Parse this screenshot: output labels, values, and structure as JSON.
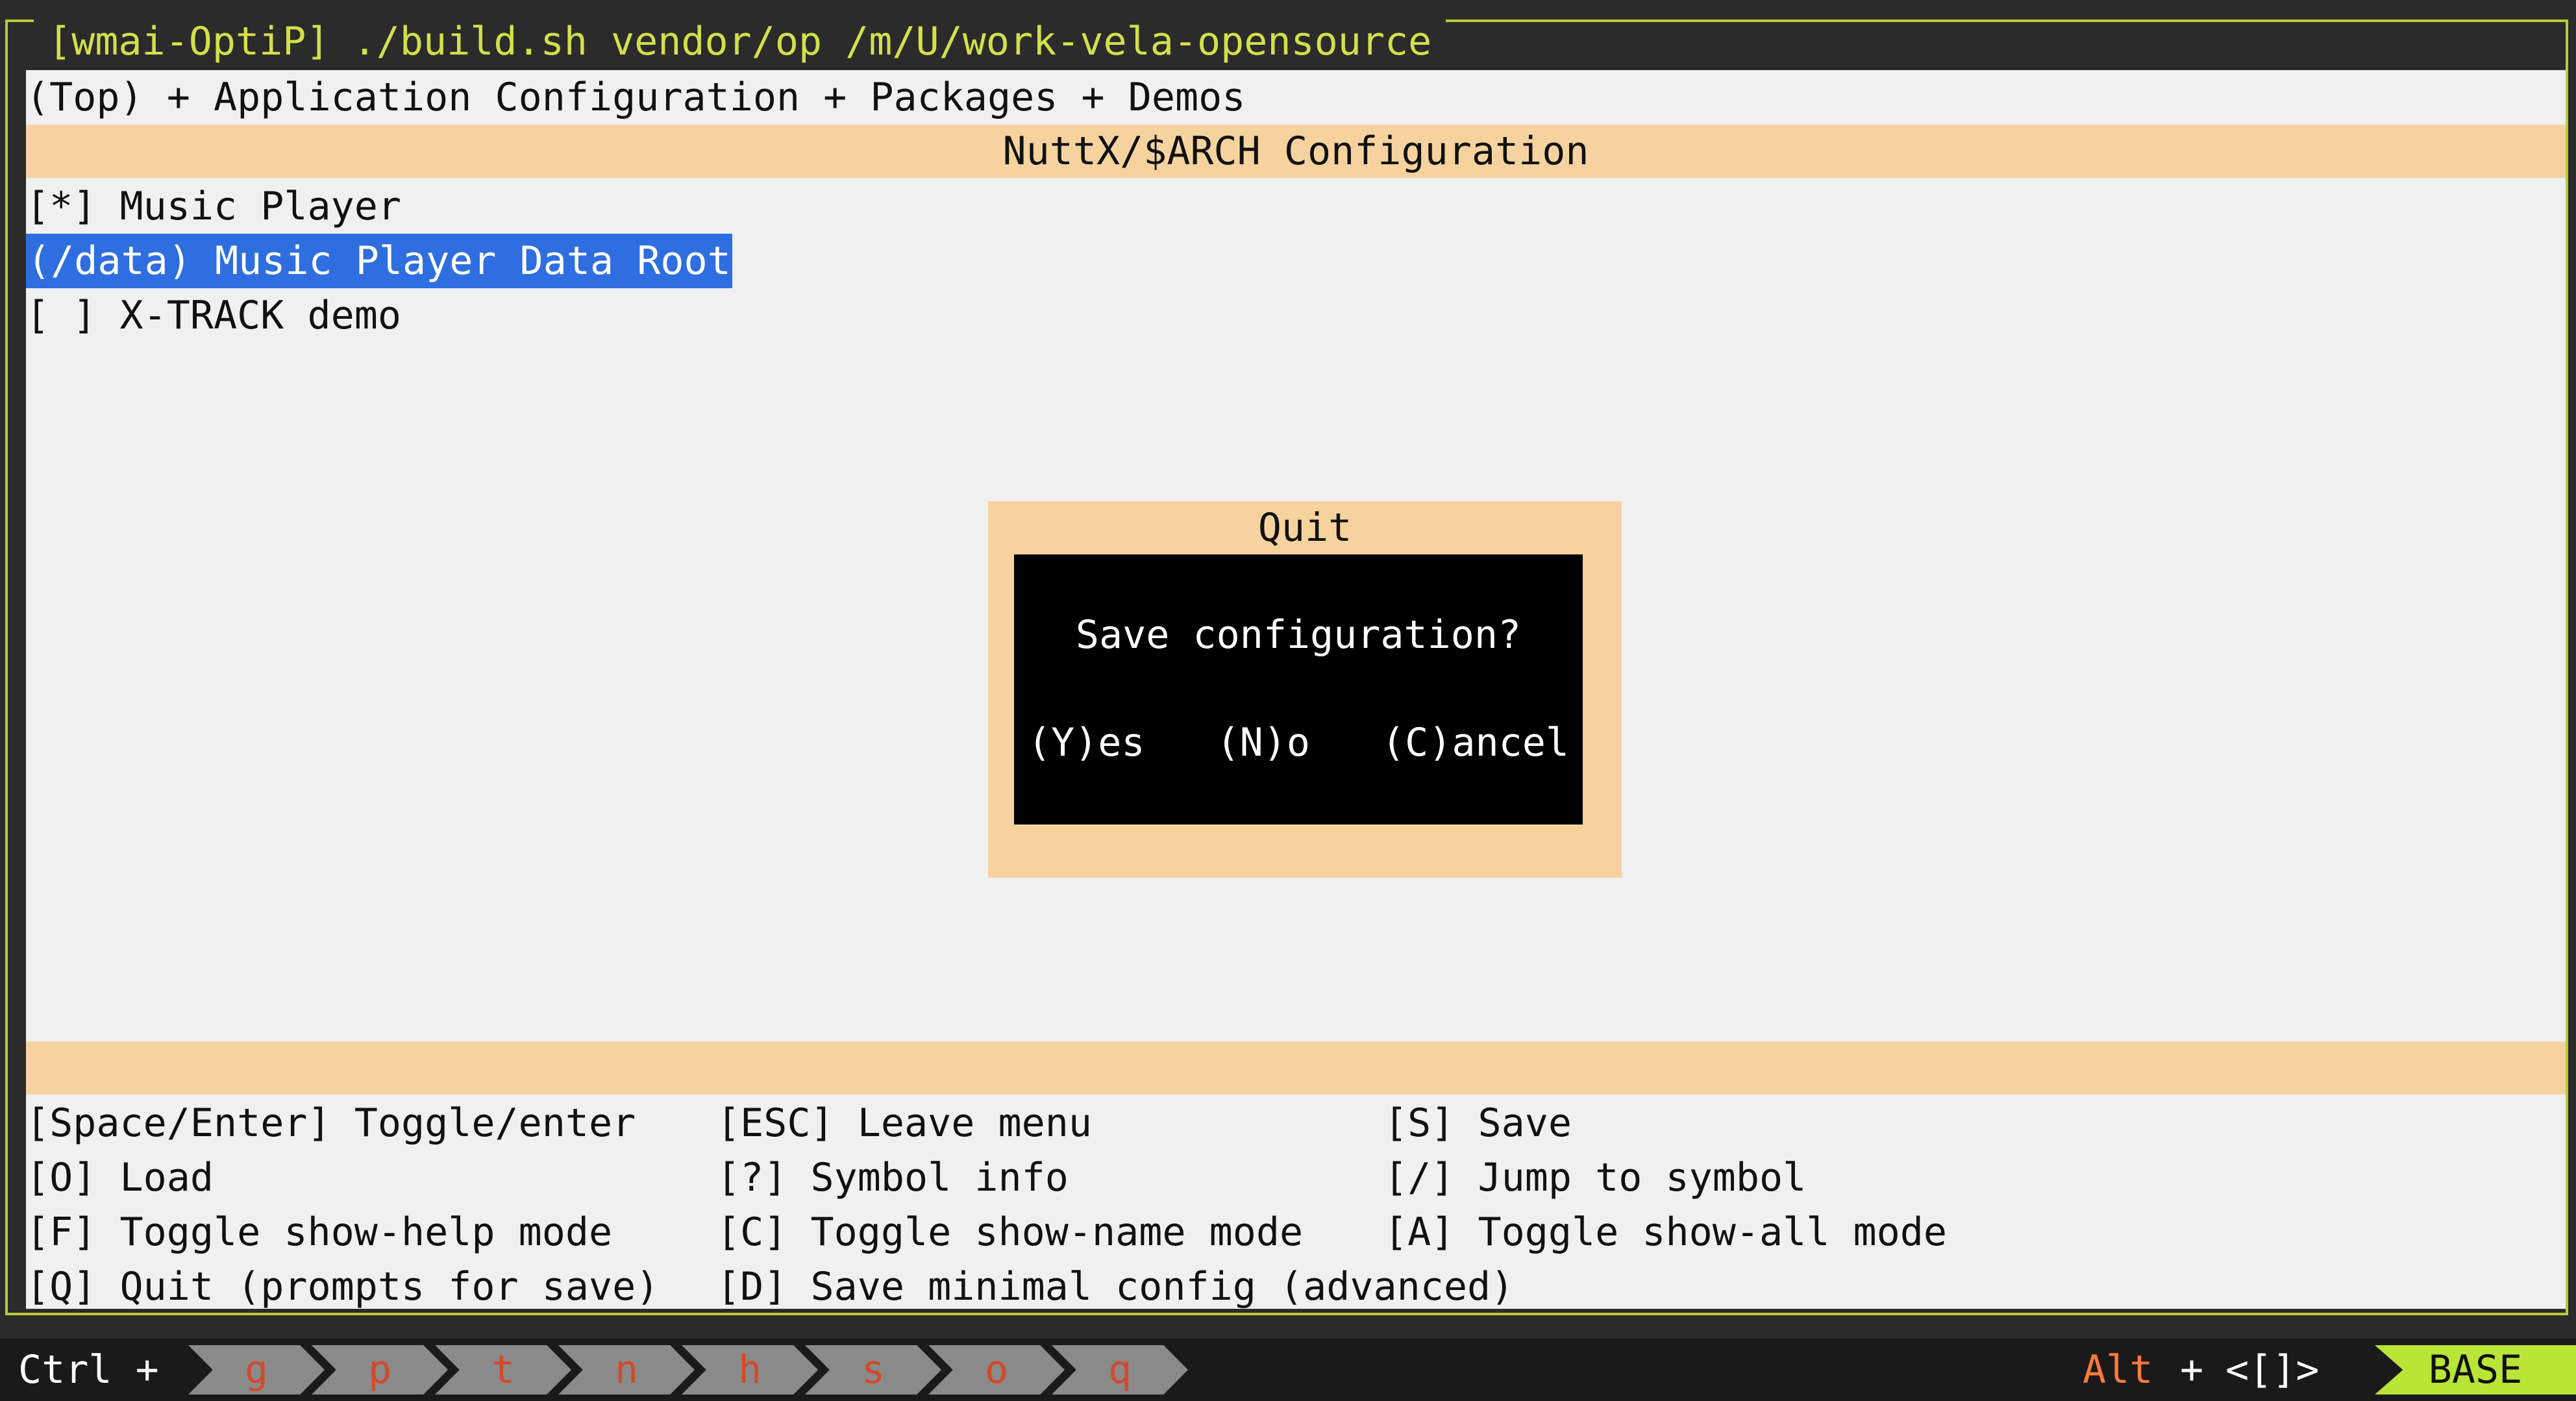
{
  "window": {
    "title": "[wmai-OptiP] ./build.sh vendor/op /m/U/work-vela-opensource"
  },
  "breadcrumb": "(Top) + Application Configuration + Packages + Demos",
  "config_title": "NuttX/$ARCH Configuration",
  "menu": {
    "items": [
      {
        "label": "[*] Music Player"
      },
      {
        "label": "(/data) Music Player Data Root"
      },
      {
        "label": "[ ] X-TRACK demo"
      }
    ]
  },
  "dialog": {
    "title": "Quit",
    "message": "Save configuration?",
    "buttons": [
      "(Y)es",
      "(N)o",
      "(C)ancel"
    ]
  },
  "help": {
    "rows": [
      [
        "[Space/Enter] Toggle/enter",
        "[ESC] Leave menu",
        "[S] Save"
      ],
      [
        "[O] Load",
        "[?] Symbol info",
        "[/] Jump to symbol"
      ],
      [
        "[F] Toggle show-help mode",
        "[C] Toggle show-name mode",
        "[A] Toggle show-all mode"
      ],
      [
        "[Q] Quit (prompts for save)",
        "[D] Save minimal config (advanced)",
        ""
      ]
    ]
  },
  "statusbar": {
    "ctrl_label": "Ctrl +",
    "keys": [
      "g",
      "p",
      "t",
      "n",
      "h",
      "s",
      "o",
      "q"
    ],
    "alt_label": "Alt",
    "alt_plus": "+",
    "alt_keys": "<[]>",
    "mode": "BASE"
  },
  "colors": {
    "frame_border": "#b8c93a",
    "title_text": "#d2e04a",
    "band": "#f6d39e",
    "selection": "#2f6ee0",
    "mode_badge": "#b9e536",
    "key_text": "#d24a2a"
  }
}
